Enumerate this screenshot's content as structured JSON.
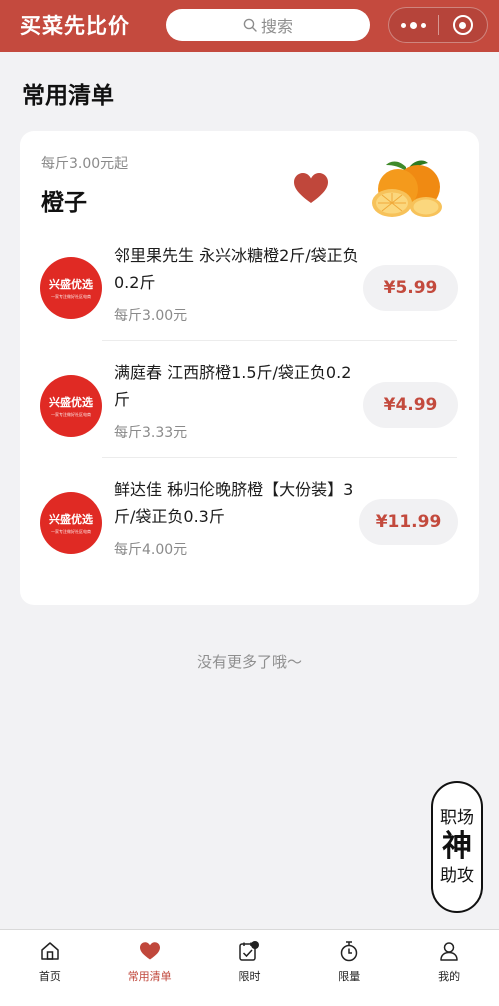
{
  "header": {
    "app_title": "买菜先比价",
    "search_placeholder": "搜索",
    "menu_icon": "more-dots-icon",
    "close_icon": "target-icon"
  },
  "section_title": "常用清单",
  "product": {
    "unit_note": "每斤3.00元起",
    "name": "橙子",
    "favorite_icon": "heart-icon",
    "image": "orange-image",
    "offers": [
      {
        "store_logo_text": "兴盛优选",
        "store_logo_subtext": "一家专注做好社区电商",
        "title": "邻里果先生 永兴冰糖橙2斤/袋正负0.2斤",
        "unit_price": "每斤3.00元",
        "price": "¥5.99"
      },
      {
        "store_logo_text": "兴盛优选",
        "store_logo_subtext": "一家专注做好社区电商",
        "title": "满庭春 江西脐橙1.5斤/袋正负0.2斤",
        "unit_price": "每斤3.33元",
        "price": "¥4.99"
      },
      {
        "store_logo_text": "兴盛优选",
        "store_logo_subtext": "一家专注做好社区电商",
        "title": "鲜达佳 秭归伦晚脐橙【大份装】3斤/袋正负0.3斤",
        "unit_price": "每斤4.00元",
        "price": "¥11.99"
      }
    ]
  },
  "footer_note": "没有更多了哦～",
  "watermark": {
    "line1": "职场",
    "line2": "神",
    "line3": "助攻"
  },
  "tabbar": {
    "tabs": [
      {
        "label": "首页",
        "icon": "home-icon",
        "active": false
      },
      {
        "label": "常用清单",
        "icon": "heart-icon",
        "active": true
      },
      {
        "label": "限时",
        "icon": "timer-box-icon",
        "active": false
      },
      {
        "label": "限量",
        "icon": "stopwatch-icon",
        "active": false
      },
      {
        "label": "我的",
        "icon": "user-icon",
        "active": false
      }
    ]
  },
  "colors": {
    "brand": "#c44a3e",
    "price_text": "#c34a3d",
    "store_logo": "#e02a24",
    "background": "#f2f2f4"
  }
}
